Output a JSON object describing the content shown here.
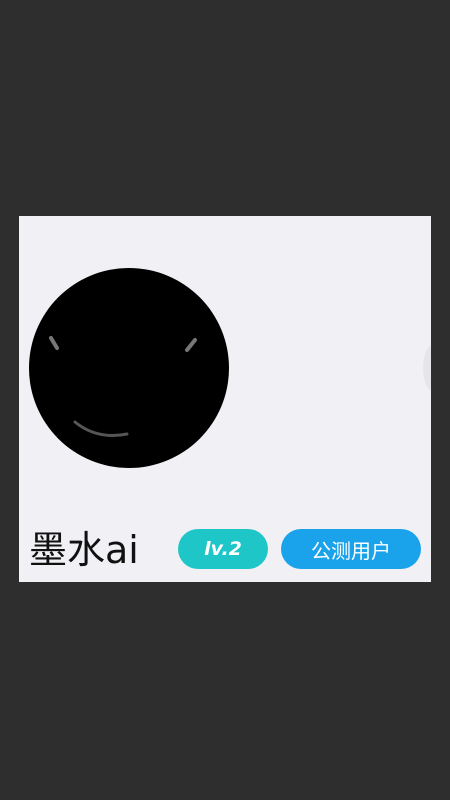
{
  "profile": {
    "username": "墨水ai",
    "level_badge": "lv.2",
    "status_badge": "公测用户"
  },
  "colors": {
    "background": "#2e2e2e",
    "card": "#f1f1f5",
    "level_badge": "#1fc6c8",
    "status_badge": "#1aa3ea"
  },
  "icons": {
    "avatar": "smiling-face-avatar-icon"
  }
}
